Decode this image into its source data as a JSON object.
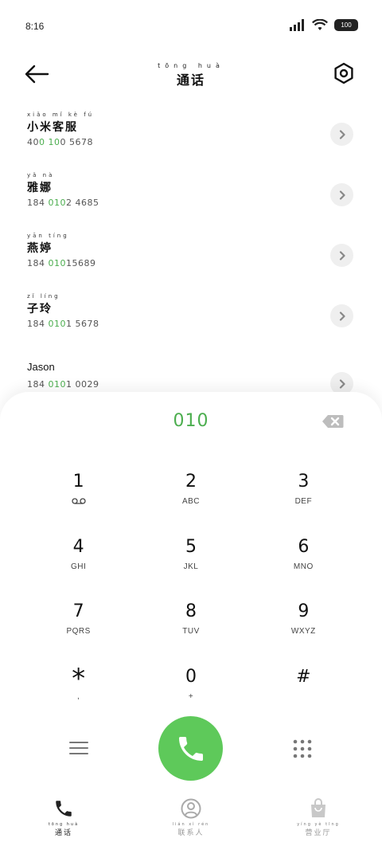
{
  "status_bar": {
    "time": "8:16",
    "battery": "100"
  },
  "header": {
    "title": "通话",
    "title_pinyin": "tōng huà"
  },
  "contacts": [
    {
      "pinyin": "xiǎo mǐ kè fú",
      "name": "小米客服",
      "number_pre": "40",
      "number_hl1": "0",
      "number_mid": " ",
      "number_hl2": "10",
      "number_post": "0 5678"
    },
    {
      "pinyin": "yǎ nà",
      "name": "雅娜",
      "number_pre": "184 ",
      "number_hl1": "010",
      "number_mid": "",
      "number_hl2": "",
      "number_post": "2 4685"
    },
    {
      "pinyin": "yān tíng",
      "name": "燕婷",
      "number_pre": "184 ",
      "number_hl1": "010",
      "number_mid": "",
      "number_hl2": "",
      "number_post": "15689"
    },
    {
      "pinyin": "zǐ líng",
      "name": "子玲",
      "number_pre": "184 ",
      "number_hl1": "010",
      "number_mid": "",
      "number_hl2": "",
      "number_post": "1 5678"
    },
    {
      "pinyin": "",
      "name": "Jason",
      "number_pre": "184 ",
      "number_hl1": "010",
      "number_mid": "",
      "number_hl2": "",
      "number_post": "1 0029"
    }
  ],
  "dialer": {
    "input_value": "010",
    "keys": [
      {
        "digit": "1",
        "letters": "",
        "icon": "voicemail-icon"
      },
      {
        "digit": "2",
        "letters": "ABC"
      },
      {
        "digit": "3",
        "letters": "DEF"
      },
      {
        "digit": "4",
        "letters": "GHI"
      },
      {
        "digit": "5",
        "letters": "JKL"
      },
      {
        "digit": "6",
        "letters": "MNO"
      },
      {
        "digit": "7",
        "letters": "PQRS"
      },
      {
        "digit": "8",
        "letters": "TUV"
      },
      {
        "digit": "9",
        "letters": "WXYZ"
      },
      {
        "digit": "*",
        "letters": ","
      },
      {
        "digit": "0",
        "letters": "+"
      },
      {
        "digit": "#",
        "letters": ""
      }
    ]
  },
  "bottom_nav": [
    {
      "label": "通话",
      "pinyin": "tōng huà",
      "icon": "phone-icon",
      "active": true
    },
    {
      "label": "联系人",
      "pinyin": "lián xì rén",
      "icon": "contacts-icon",
      "active": false
    },
    {
      "label": "营业厅",
      "pinyin": "yíng yè tīng",
      "icon": "shop-bag-icon",
      "active": false
    }
  ],
  "colors": {
    "accent": "#4cae4f",
    "call_button": "#5ec95a"
  }
}
